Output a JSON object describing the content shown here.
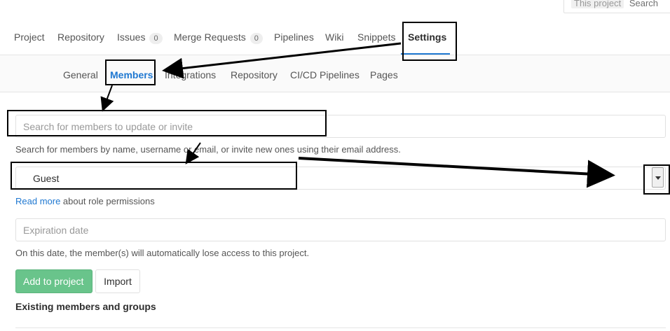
{
  "header": {
    "search_scope": "This project",
    "search_label": "Search"
  },
  "nav": {
    "items": [
      {
        "label": "Project"
      },
      {
        "label": "Repository"
      },
      {
        "label": "Issues",
        "count": "0"
      },
      {
        "label": "Merge Requests",
        "count": "0"
      },
      {
        "label": "Pipelines"
      },
      {
        "label": "Wiki"
      },
      {
        "label": "Snippets"
      },
      {
        "label": "Settings",
        "active": true
      }
    ]
  },
  "subnav": {
    "items": [
      {
        "label": "General"
      },
      {
        "label": "Members",
        "active": true
      },
      {
        "label": "Integrations"
      },
      {
        "label": "Repository"
      },
      {
        "label": "CI/CD Pipelines"
      },
      {
        "label": "Pages"
      }
    ]
  },
  "form": {
    "member_search_placeholder": "Search for members to update or invite",
    "member_search_help": "Search for members by name, username or email, or invite new ones using their email address.",
    "role_value": "Guest",
    "read_more_link": "Read more",
    "read_more_suffix": " about role permissions",
    "expiration_placeholder": "Expiration date",
    "expiration_help": "On this date, the member(s) will automatically lose access to this project.",
    "add_button": "Add to project",
    "import_button": "Import"
  },
  "existing_section": {
    "title": "Existing members and groups"
  },
  "colors": {
    "accent": "#1f78d1",
    "success": "#69c48b"
  }
}
